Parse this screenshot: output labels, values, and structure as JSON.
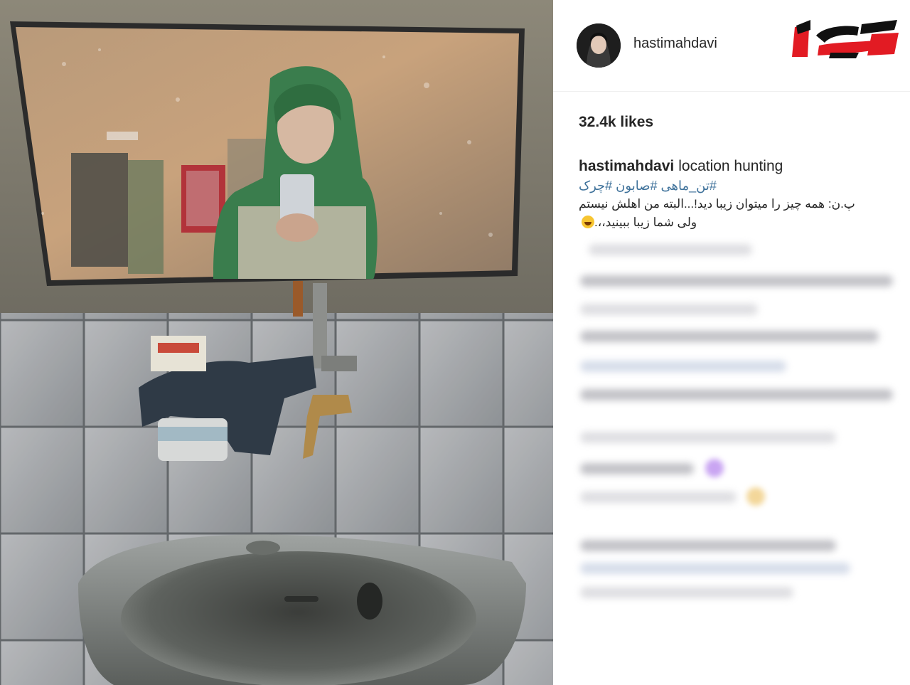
{
  "post": {
    "username": "hastimahdavi",
    "likes": "32.4k likes",
    "caption_text": "location hunting",
    "hashtags": "#تن_ماهی #صابون #چرک",
    "body_line1": "پ.ن: همه چیز را میتوان زیبا دید!...البته من اهلش نیستم",
    "body_line2": "ولی شما زیبا ببینید،،."
  },
  "icons": {
    "avatar": "profile-photo",
    "brand": "rokna-logo",
    "emoji": "laughing-emoji"
  },
  "colors": {
    "hashtag": "#3f729b",
    "brand_red": "#e21b23",
    "brand_black": "#111111"
  }
}
